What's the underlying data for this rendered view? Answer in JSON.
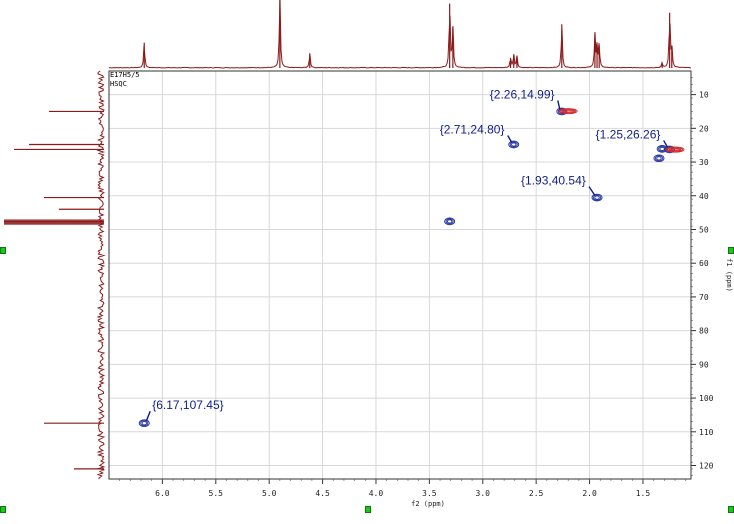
{
  "header": {
    "sample_id": "E17H5/5",
    "experiment": "HSQC"
  },
  "chart_data": {
    "type": "scatter",
    "subtype": "2D NMR HSQC contour plot",
    "xlabel": "f2 (ppm)",
    "ylabel": "f1 (ppm)",
    "xlim": [
      6.5,
      1.05
    ],
    "ylim": [
      3,
      124
    ],
    "x_reversed": true,
    "x_ticks": [
      "6.0",
      "5.5",
      "5.0",
      "4.5",
      "4.0",
      "3.5",
      "3.0",
      "2.5",
      "2.0",
      "1.5"
    ],
    "y_ticks": [
      "10",
      "20",
      "30",
      "40",
      "50",
      "60",
      "70",
      "80",
      "90",
      "100",
      "110",
      "120"
    ],
    "grid": true,
    "peaks": [
      {
        "x": 2.26,
        "y": 14.99,
        "label": "{2.26,14.99}",
        "phase": "positive"
      },
      {
        "x": 2.71,
        "y": 24.8,
        "label": "{2.71,24.80}",
        "phase": "positive"
      },
      {
        "x": 1.25,
        "y": 26.26,
        "label": "{1.25,26.26}",
        "phase": "positive"
      },
      {
        "x": 1.93,
        "y": 40.54,
        "label": "{1.93,40.54}",
        "phase": "positive"
      },
      {
        "x": 6.17,
        "y": 107.45,
        "label": "{6.17,107.45}",
        "phase": "positive"
      },
      {
        "x": 3.31,
        "y": 47.6,
        "label": "",
        "phase": "positive"
      },
      {
        "x": 1.32,
        "y": 26.1,
        "label": "",
        "phase": "positive"
      },
      {
        "x": 1.35,
        "y": 28.9,
        "label": "",
        "phase": "positive"
      },
      {
        "x": 1.2,
        "y": 26.3,
        "label": "",
        "phase": "negative"
      },
      {
        "x": 2.2,
        "y": 14.9,
        "label": "",
        "phase": "negative"
      }
    ],
    "proton_trace_peaks": [
      {
        "ppm": 6.17,
        "height": 0.55
      },
      {
        "ppm": 4.9,
        "height": 1.6
      },
      {
        "ppm": 4.62,
        "height": 0.32
      },
      {
        "ppm": 3.31,
        "height": 1.4
      },
      {
        "ppm": 3.28,
        "height": 0.9
      },
      {
        "ppm": 2.74,
        "height": 0.22
      },
      {
        "ppm": 2.71,
        "height": 0.3
      },
      {
        "ppm": 2.68,
        "height": 0.25
      },
      {
        "ppm": 2.26,
        "height": 0.95
      },
      {
        "ppm": 1.95,
        "height": 0.75
      },
      {
        "ppm": 1.93,
        "height": 0.45
      },
      {
        "ppm": 1.91,
        "height": 0.5
      },
      {
        "ppm": 1.32,
        "height": 0.1
      },
      {
        "ppm": 1.25,
        "height": 1.2
      },
      {
        "ppm": 1.23,
        "height": 0.45
      }
    ],
    "carbon_trace_peaks": [
      {
        "ppm": 14.99,
        "height": 0.55
      },
      {
        "ppm": 24.8,
        "height": 0.75
      },
      {
        "ppm": 26.26,
        "height": 0.9
      },
      {
        "ppm": 40.54,
        "height": 0.6
      },
      {
        "ppm": 44.0,
        "height": 0.45
      },
      {
        "ppm": 47.2,
        "height": 1.0
      },
      {
        "ppm": 47.6,
        "height": 1.0
      },
      {
        "ppm": 48.0,
        "height": 1.0
      },
      {
        "ppm": 48.4,
        "height": 1.0
      },
      {
        "ppm": 107.45,
        "height": 0.6
      },
      {
        "ppm": 121.0,
        "height": 0.3
      }
    ],
    "colors": {
      "trace": "#8b1a1a",
      "positive_contour": "#1c2d9e",
      "negative_contour": "#d22a2a",
      "label": "#0f1e8c",
      "grid": "#d8d8d8",
      "handle": "#19c619"
    }
  }
}
